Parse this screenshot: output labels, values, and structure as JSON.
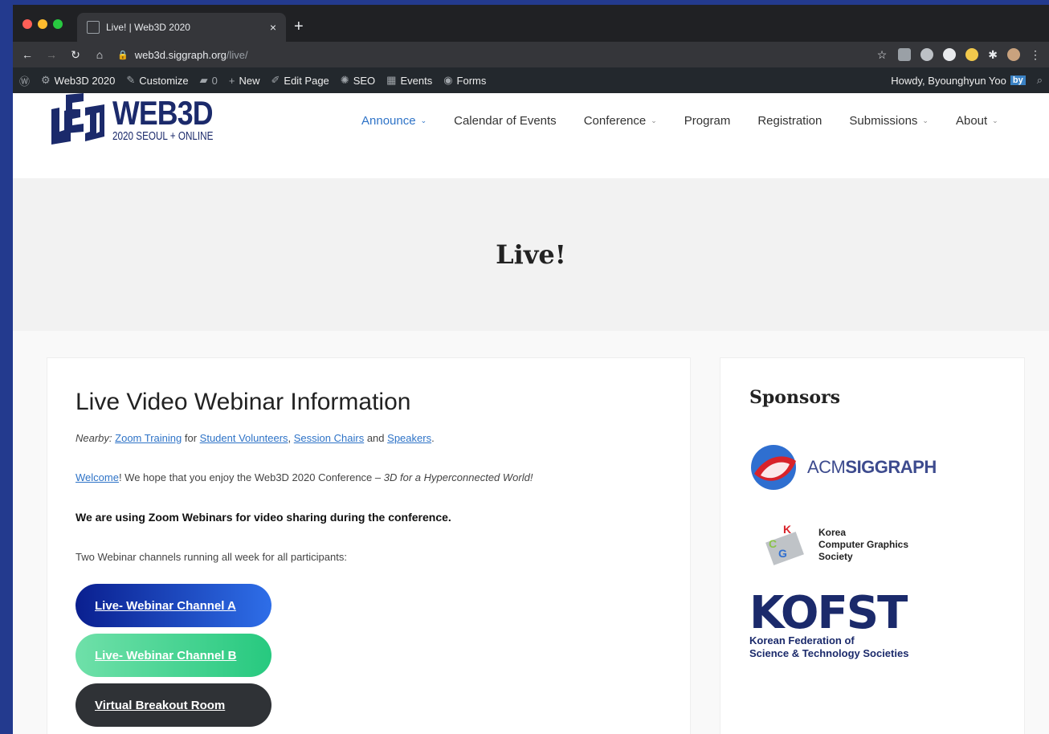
{
  "browser": {
    "tab_title": "Live! | Web3D 2020",
    "tab_close": "×",
    "new_tab": "+",
    "url_host": "web3d.siggraph.org",
    "url_path": "/live/",
    "colors": {
      "close": "#ff5f57",
      "minimize": "#febc2e",
      "zoom": "#28c840"
    }
  },
  "adminbar": {
    "site": "Web3D 2020",
    "customize": "Customize",
    "comments": "0",
    "new": "New",
    "edit_page": "Edit Page",
    "seo": "SEO",
    "events": "Events",
    "forms": "Forms",
    "howdy": "Howdy, Byounghyun Yoo",
    "avatar_text": "by"
  },
  "header": {
    "logo_big": "WEB3D",
    "logo_sub": "2020 SEOUL + ONLINE",
    "nav": [
      {
        "label": "Announce"
      },
      {
        "label": "Calendar of Events"
      },
      {
        "label": "Conference"
      },
      {
        "label": "Program"
      },
      {
        "label": "Registration"
      },
      {
        "label": "Submissions"
      },
      {
        "label": "About"
      }
    ]
  },
  "hero": {
    "title": "Live!"
  },
  "main": {
    "heading": "Live Video Webinar Information",
    "nearby_label": "Nearby:",
    "zoom_training": "Zoom Training",
    "for_text": "for",
    "student_volunteers": "Student Volunteers",
    "session_chairs": "Session Chairs",
    "and_text": "and",
    "speakers": "Speakers",
    "period": ".",
    "welcome_link": "Welcome",
    "welcome_text": "! We hope that you enjoy the Web3D 2020 Conference – ",
    "welcome_em": "3D for a Hyperconnected World!",
    "zoom_note": "We are using Zoom Webinars for video sharing during the conference.",
    "channels_note": "Two Webinar channels running all week for all participants:",
    "button_a": "Live- Webinar Channel A",
    "button_b": "Live- Webinar Channel B",
    "button_c": "Virtual Breakout Room"
  },
  "sidebar": {
    "title": "Sponsors",
    "acm_light": "ACM",
    "acm_bold": "SIGGRAPH",
    "kcgs_line1": "Korea",
    "kcgs_line2": "Computer Graphics",
    "kcgs_line3": "Society",
    "kcgs_k": "K",
    "kcgs_c": "C",
    "kcgs_g": "G",
    "kofst": "KOFST",
    "kofst_line1": "Korean Federation of",
    "kofst_line2": "Science & Technology Societies"
  }
}
